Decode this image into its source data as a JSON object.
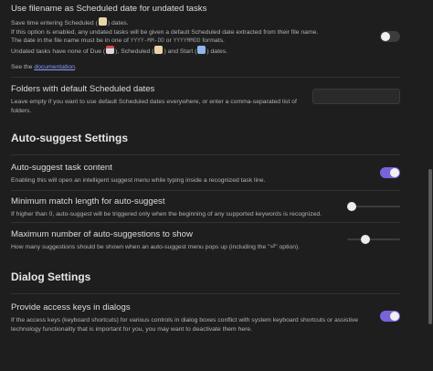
{
  "filename_setting": {
    "name": "Use filename as Scheduled date for undated tasks",
    "desc1_pre": "Save time entering Scheduled (",
    "desc1_post": ") dates.",
    "desc2": "If this option is enabled, any undated tasks will be given a default Scheduled date extracted from their file name.",
    "desc3_pre": "The date in the file name must be in one of",
    "format1": "YYYY-MM-DD",
    "desc3_mid": "or",
    "format2": "YYYYMMDD",
    "desc3_post": "formats.",
    "desc4_pre": "Undated tasks have none of Due (",
    "desc4_mid1": "), Scheduled (",
    "desc4_mid2": ") and Start (",
    "desc4_post": ") dates.",
    "see_pre": "See the",
    "see_link": "documentation",
    "see_post": ".",
    "enabled": false
  },
  "folders_setting": {
    "name": "Folders with default Scheduled dates",
    "desc": "Leave empty if you want to use default Scheduled dates everywhere, or enter a comma-separated list of folders.",
    "value": ""
  },
  "autosuggest_heading": "Auto-suggest Settings",
  "autosuggest_content": {
    "name": "Auto-suggest task content",
    "desc": "Enabling this will open an intelligent suggest menu while typing inside a recognized task line.",
    "enabled": true
  },
  "min_match": {
    "name": "Minimum match length for auto-suggest",
    "desc": "If higher than 0, auto-suggest will be triggered only when the beginning of any supported keywords is recognized.",
    "level": 0
  },
  "max_suggestions": {
    "name": "Maximum number of auto-suggestions to show",
    "desc": "How many suggestions should be shown when an auto-suggest menu pops up (including the \"⏎\" option).",
    "level": 0.2
  },
  "dialog_heading": "Dialog Settings",
  "access_keys": {
    "name": "Provide access keys in dialogs",
    "desc": "If the access keys (keyboard shortcuts) for various controls in dialog boxes conflict with system keyboard shortcuts or assistive technology functionality that is important for you, you may want to deactivate them here.",
    "enabled": true
  },
  "colors": {
    "accent": "#7a63d9",
    "background": "#1e1e1e",
    "link": "#8a9dff"
  }
}
